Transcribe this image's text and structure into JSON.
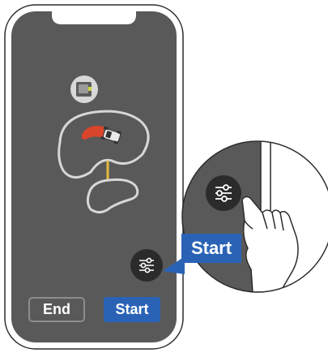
{
  "buttons": {
    "end_label": "End",
    "start_label": "Start"
  },
  "zoom_callout": {
    "start_label": "Start"
  },
  "icons": {
    "charging_station": "charging-station-icon",
    "mower": "robot-mower-icon",
    "settings": "sliders-icon",
    "hand": "pointing-hand-icon"
  },
  "colors": {
    "screen_background": "#595959",
    "accent_blue": "#2a63b6",
    "mower_area_fill": "#d9452b",
    "channel_path": "#e5b93d"
  }
}
